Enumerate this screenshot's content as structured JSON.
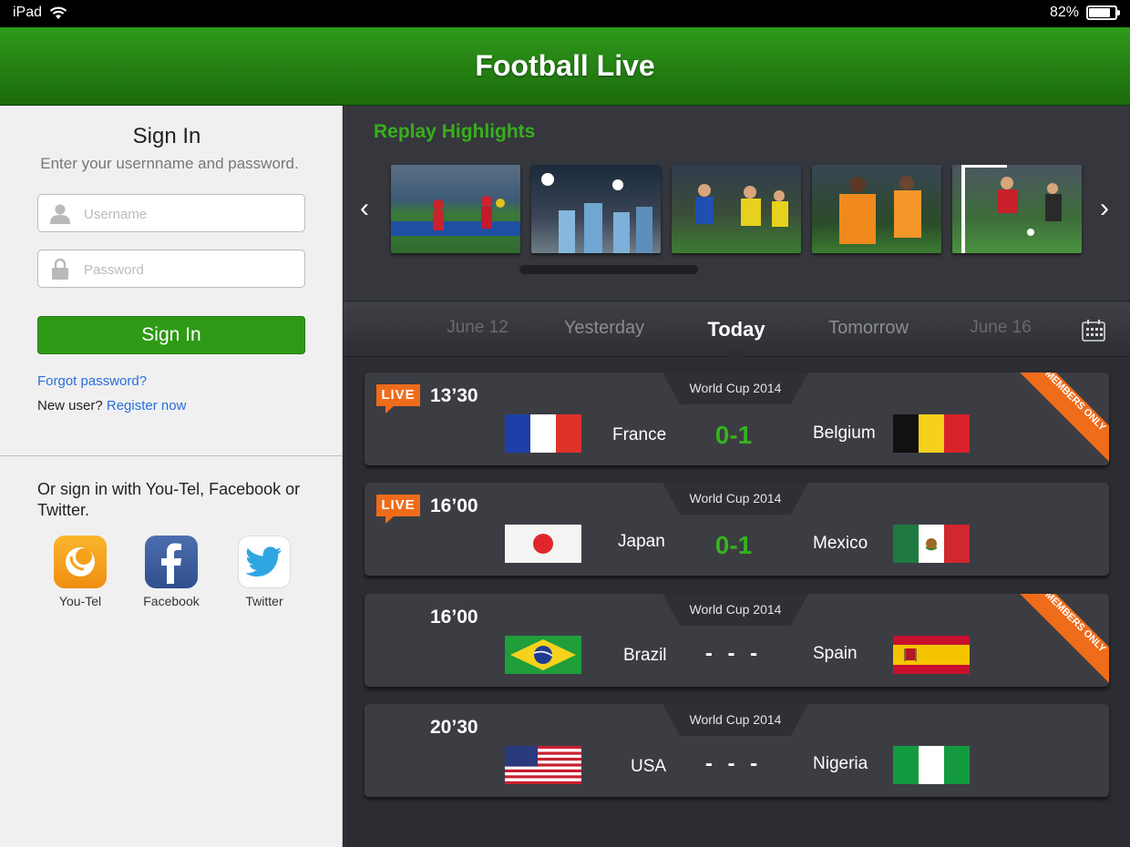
{
  "status_bar": {
    "device": "iPad",
    "battery": "82%",
    "battery_level": 0.82
  },
  "header": {
    "title": "Football Live"
  },
  "sign_in": {
    "title": "Sign In",
    "subtitle": "Enter your usernname and password.",
    "username_placeholder": "Username",
    "password_placeholder": "Password",
    "button": "Sign In",
    "forgot": "Forgot password?",
    "new_user": "New user?",
    "register": "Register now",
    "social_text": "Or sign in with You-Tel, Facebook or Twitter.",
    "social": [
      {
        "label": "You-Tel",
        "icon": "youtel-icon",
        "color": "#f7a11b"
      },
      {
        "label": "Facebook",
        "icon": "facebook-icon",
        "color": "#3b5b9b"
      },
      {
        "label": "Twitter",
        "icon": "twitter-icon",
        "color": "#2fa6e0"
      }
    ]
  },
  "highlights": {
    "title": "Replay Highlights",
    "thumbnails": [
      "highlight-1",
      "highlight-2",
      "highlight-3",
      "highlight-4",
      "highlight-5"
    ]
  },
  "dates": {
    "tabs": [
      "June 12",
      "Yesterday",
      "Today",
      "Tomorrow",
      "June 16"
    ],
    "active": "Today"
  },
  "matches": [
    {
      "live": true,
      "live_label": "LIVE",
      "time": "13’30",
      "competition": "World Cup 2014",
      "home": "France",
      "away": "Belgium",
      "score": "0-1",
      "members_only": true,
      "ribbon": "MEMBERS ONLY"
    },
    {
      "live": true,
      "live_label": "LIVE",
      "time": "16’00",
      "competition": "World Cup 2014",
      "home": "Japan",
      "away": "Mexico",
      "score": "0-1",
      "members_only": false
    },
    {
      "live": false,
      "time": "16’00",
      "competition": "World Cup 2014",
      "home": "Brazil",
      "away": "Spain",
      "score": "- - -",
      "members_only": true,
      "ribbon": "MEMBERS ONLY"
    },
    {
      "live": false,
      "time": "20’30",
      "competition": "World Cup 2014",
      "home": "USA",
      "away": "Nigeria",
      "score": "- - -",
      "members_only": false
    }
  ],
  "colors": {
    "brand_green": "#2e9a16",
    "score_green": "#37b11f",
    "live_orange": "#ef6c1a",
    "link_blue": "#2a6fdb"
  }
}
